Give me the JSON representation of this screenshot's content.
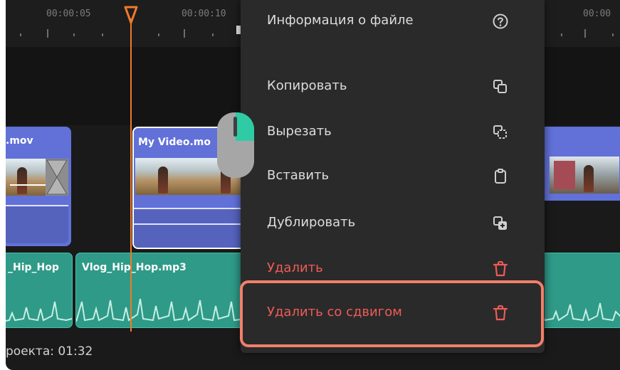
{
  "timeline": {
    "ruler_times": [
      "00:00:05",
      "00:00:10",
      "00:00"
    ],
    "video_clips": [
      {
        "title": ".mov"
      },
      {
        "title": "My Video.mo"
      },
      {
        "title": ""
      }
    ],
    "audio_clips": [
      {
        "title": "_Hip_Hop"
      },
      {
        "title": "Vlog_Hip_Hop.mp3"
      }
    ],
    "status": {
      "text": "роекта: 01:32"
    }
  },
  "context_menu": {
    "items": [
      {
        "label": "Информация о файле",
        "icon": "question-circle-icon"
      },
      {
        "label": "Копировать",
        "icon": "copy-icon"
      },
      {
        "label": "Вырезать",
        "icon": "cut-icon"
      },
      {
        "label": "Вставить",
        "icon": "clipboard-icon"
      },
      {
        "label": "Дублировать",
        "icon": "duplicate-icon"
      },
      {
        "label": "Удалить",
        "icon": "trash-icon"
      },
      {
        "label": "Удалить со сдвигом",
        "icon": "trash-icon"
      }
    ],
    "highlighted_item": "Удалить со сдвигом"
  },
  "colors": {
    "background": "#1a1a1a",
    "menu_background": "#2a2a2a",
    "video_clip": "#6171d8",
    "audio_clip": "#2f9a88",
    "playhead": "#f07a2a",
    "danger_text": "#ef5b57",
    "highlight_border": "#f27f6a",
    "mouse_button": "#2ecba5"
  }
}
